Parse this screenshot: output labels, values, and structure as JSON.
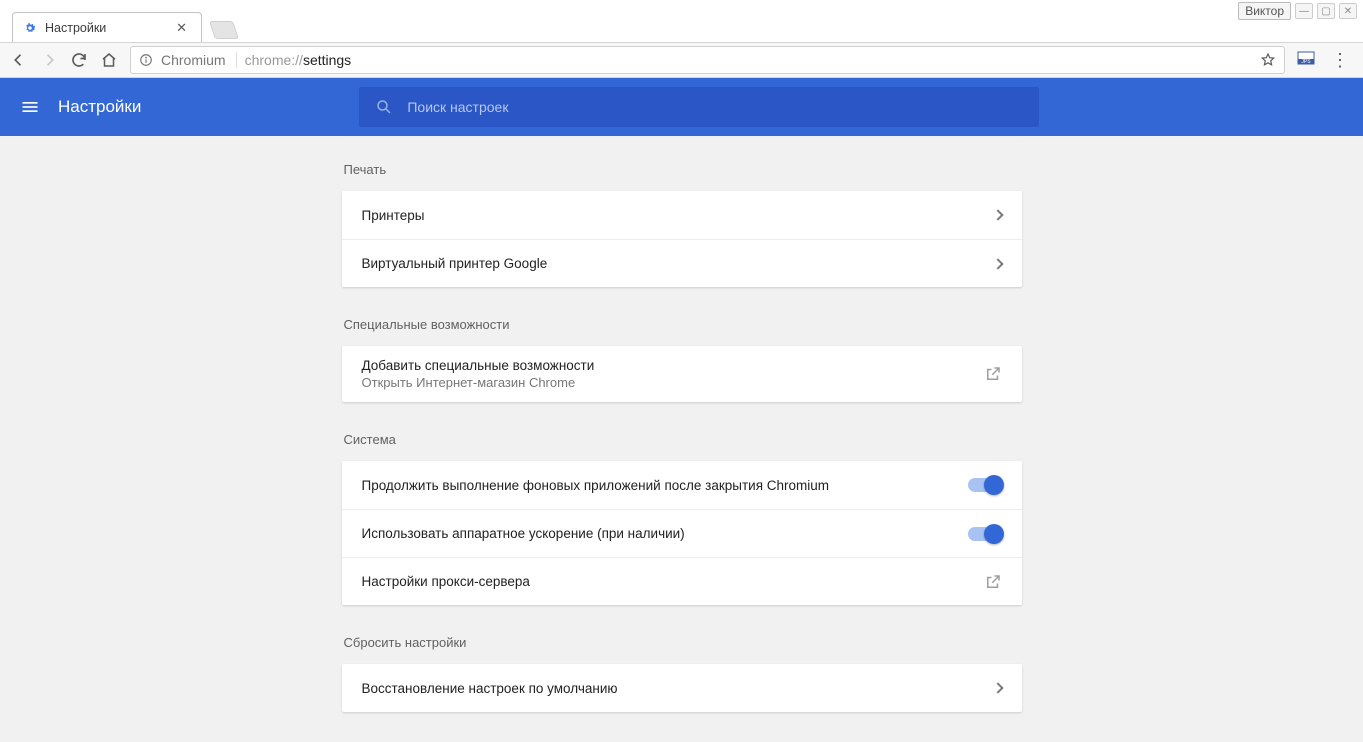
{
  "os": {
    "user": "Виктор"
  },
  "tab": {
    "title": "Настройки"
  },
  "omnibox": {
    "origin": "Chromium",
    "url_prefix": "chrome://",
    "url_path": "settings"
  },
  "header": {
    "title": "Настройки"
  },
  "search": {
    "placeholder": "Поиск настроек"
  },
  "sections": {
    "print": {
      "label": "Печать",
      "printers": "Принтеры",
      "cloud_print": "Виртуальный принтер Google"
    },
    "a11y": {
      "label": "Специальные возможности",
      "add_title": "Добавить специальные возможности",
      "add_sub": "Открыть Интернет-магазин Chrome"
    },
    "system": {
      "label": "Система",
      "bg_apps": "Продолжить выполнение фоновых приложений после закрытия Chromium",
      "hw_accel": "Использовать аппаратное ускорение (при наличии)",
      "proxy": "Настройки прокси-сервера"
    },
    "reset": {
      "label": "Сбросить настройки",
      "restore": "Восстановление настроек по умолчанию"
    }
  }
}
